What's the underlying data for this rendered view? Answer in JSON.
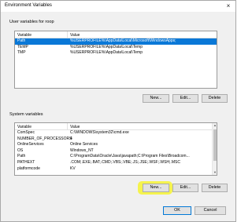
{
  "window": {
    "title": "Environment Variables",
    "close": "×"
  },
  "user_section": {
    "label": "User variables for roop",
    "columns": [
      "Variable",
      "Value"
    ],
    "rows": [
      {
        "variable": "Path",
        "value": "%USERPROFILE%\\AppData\\Local\\Microsoft\\WindowsApps;",
        "selected": true
      },
      {
        "variable": "TEMP",
        "value": "%USERPROFILE%\\AppData\\Local\\Temp"
      },
      {
        "variable": "TMP",
        "value": "%USERPROFILE%\\AppData\\Local\\Temp"
      }
    ],
    "buttons": {
      "new": "New...",
      "edit": "Edit...",
      "delete": "Delete"
    }
  },
  "system_section": {
    "label": "System variables",
    "columns": [
      "Variable",
      "Value"
    ],
    "rows": [
      {
        "variable": "ComSpec",
        "value": "C:\\WINDOWS\\system32\\cmd.exe"
      },
      {
        "variable": "NUMBER_OF_PROCESSORS",
        "value": "4"
      },
      {
        "variable": "OnlineServices",
        "value": "Online Services"
      },
      {
        "variable": "OS",
        "value": "Windows_NT"
      },
      {
        "variable": "Path",
        "value": "C:\\ProgramData\\Oracle\\Java\\javapath;C:\\Program Files\\Broadcom..."
      },
      {
        "variable": "PATHEXT",
        "value": ".COM;.EXE;.BAT;.CMD;.VBS;.VBE;.JS;.JSE;.WSF;.WSH;.MSC"
      },
      {
        "variable": "platformcode",
        "value": "KV"
      }
    ],
    "buttons": {
      "new": "New...",
      "edit": "Edit...",
      "delete": "Delete"
    }
  },
  "footer": {
    "ok": "OK",
    "cancel": "Cancel"
  },
  "colors": {
    "selection": "#0a78d7",
    "highlight": "#f4f244",
    "primary_border": "#0078d7"
  }
}
